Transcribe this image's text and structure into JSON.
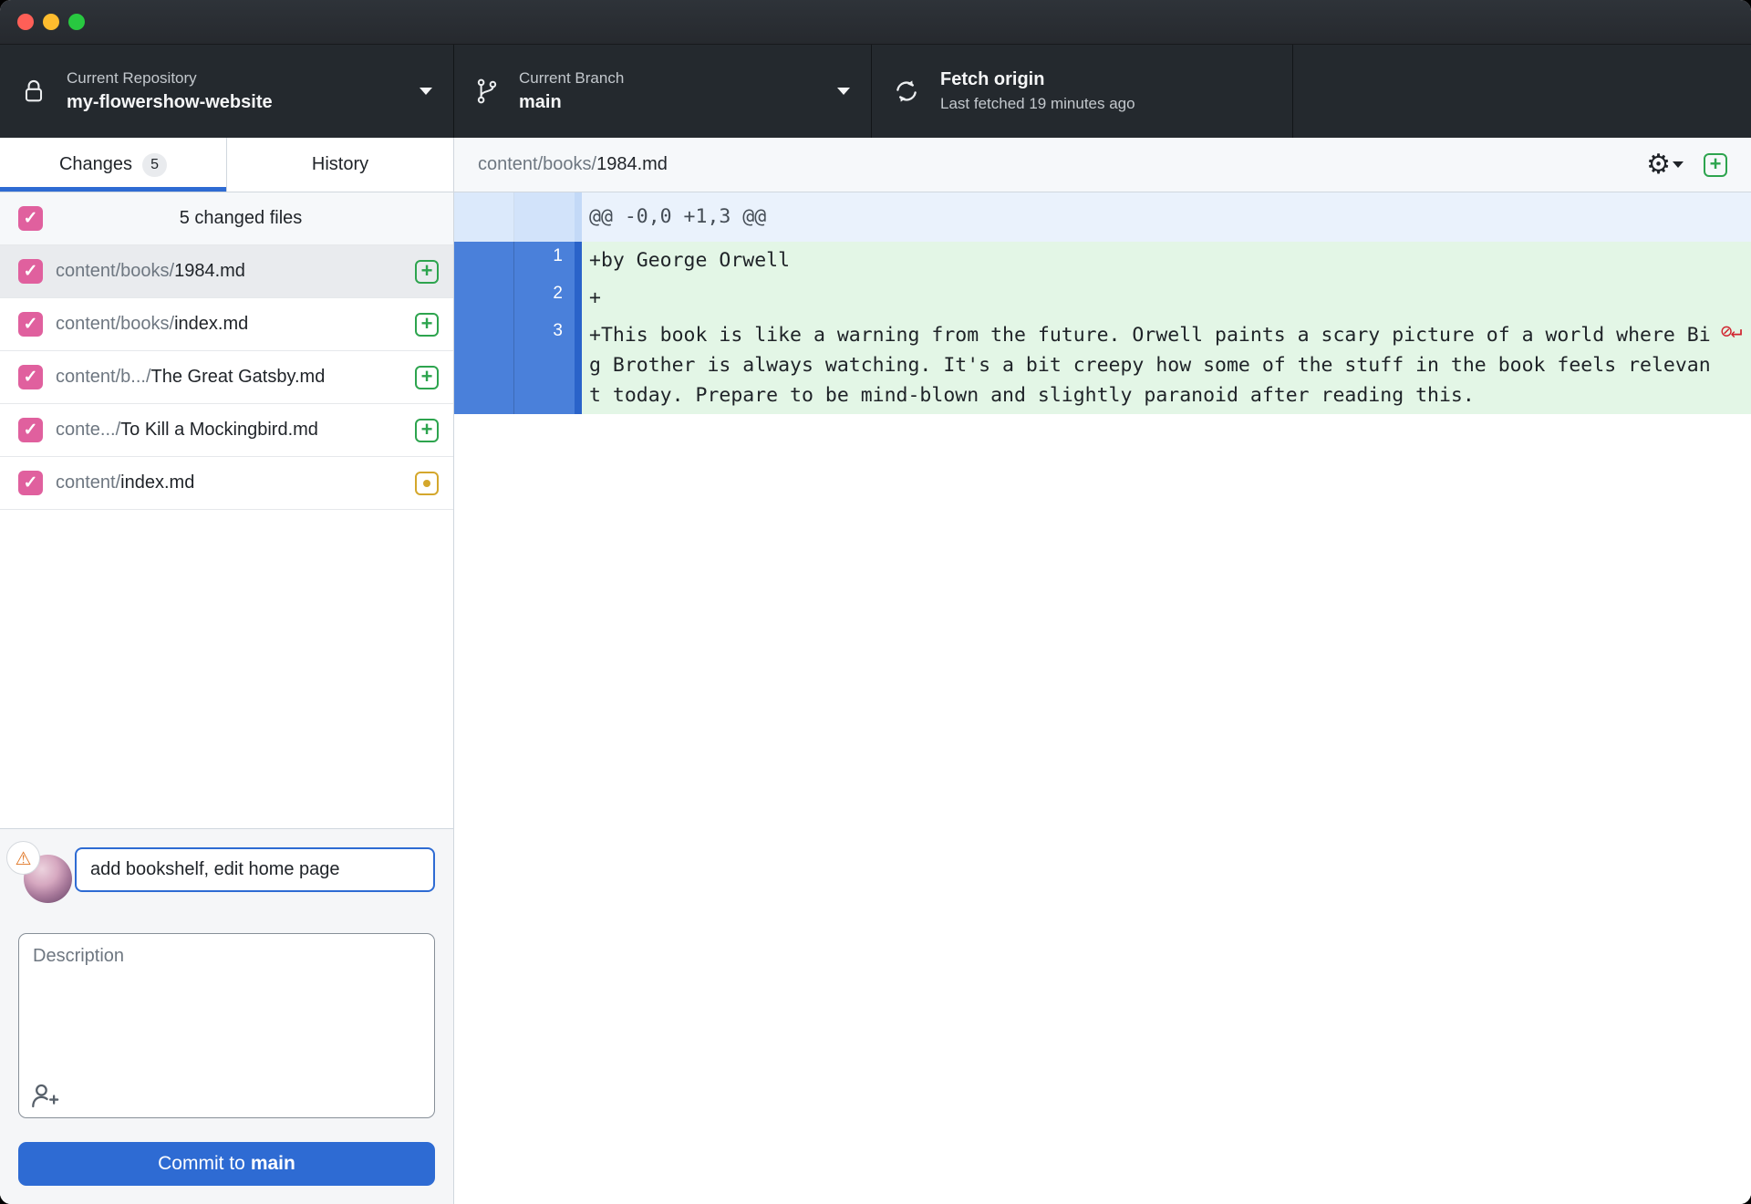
{
  "window": {
    "traffic_lights": [
      "close",
      "minimize",
      "zoom"
    ]
  },
  "toolbar": {
    "repository": {
      "label": "Current Repository",
      "value": "my-flowershow-website",
      "icon": "lock-icon"
    },
    "branch": {
      "label": "Current Branch",
      "value": "main",
      "icon": "git-branch-icon"
    },
    "fetch": {
      "title": "Fetch origin",
      "subtitle": "Last fetched 19 minutes ago",
      "icon": "sync-icon"
    }
  },
  "sidebar": {
    "tabs": [
      {
        "label": "Changes",
        "badge": "5",
        "active": true
      },
      {
        "label": "History",
        "active": false
      }
    ],
    "list_header": {
      "label": "5 changed files",
      "checked": true
    },
    "files": [
      {
        "path_prefix": "content/books/",
        "name": "1984.md",
        "status": "added",
        "selected": true,
        "checked": true
      },
      {
        "path_prefix": "content/books/",
        "name": "index.md",
        "status": "added",
        "selected": false,
        "checked": true
      },
      {
        "path_prefix": "content/b.../",
        "name": "The Great Gatsby.md",
        "status": "added",
        "selected": false,
        "checked": true
      },
      {
        "path_prefix": "conte.../",
        "name": "To Kill a Mockingbird.md",
        "status": "added",
        "selected": false,
        "checked": true
      },
      {
        "path_prefix": "content/",
        "name": "index.md",
        "status": "modified",
        "selected": false,
        "checked": true
      }
    ],
    "commit": {
      "summary_value": "add bookshelf, edit home page",
      "description_placeholder": "Description",
      "button_prefix": "Commit to",
      "button_branch": "main",
      "warning_glyph": "⚠",
      "coauthor_icon": "person-add-icon"
    }
  },
  "diff": {
    "file_path_prefix": "content/books/",
    "file_name": "1984.md",
    "actions": {
      "settings_icon": "gear-icon",
      "settings_glyph": "⚙",
      "expand_icon": "plus-square-icon"
    },
    "hunk_header": "@@ -0,0 +1,3 @@",
    "lines": [
      {
        "number": "1",
        "text": "+by George Orwell",
        "no_newline": false
      },
      {
        "number": "2",
        "text": "+",
        "no_newline": false
      },
      {
        "number": "3",
        "text": "+This book is like a warning from the future. Orwell paints a scary picture of a world where Big Brother is always watching. It's a bit creepy how some of the stuff in the book feels relevant today. Prepare to be mind-blown and slightly paranoid after reading this.",
        "no_newline": true
      }
    ],
    "no_newline_glyph": "⊘↵"
  },
  "colors": {
    "accent_blue": "#2e6bd3",
    "checkbox_pink": "#e0609e",
    "added_green": "#2da44e",
    "modified_yellow": "#d4a72c",
    "warning_orange": "#e17726",
    "no_newline_red": "#d1242f",
    "toolbar_bg": "#24292e",
    "diff_added_bg": "#e3f6e6",
    "diff_gutter_blue": "#4a80da"
  }
}
